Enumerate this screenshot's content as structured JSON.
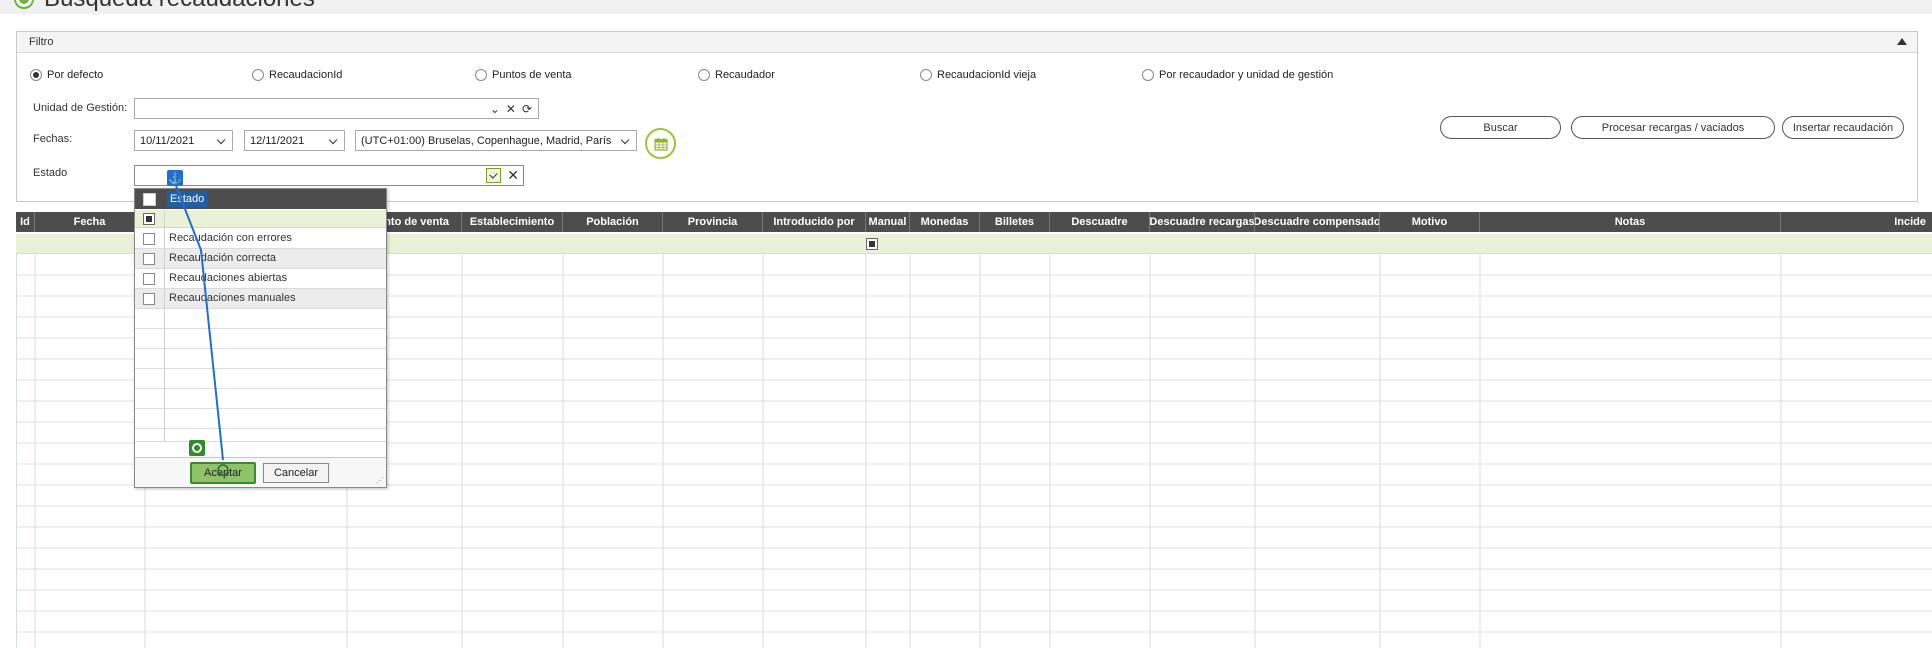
{
  "page": {
    "title": "Búsqueda recaudaciones"
  },
  "filter": {
    "title": "Filtro",
    "radios": [
      {
        "label": "Por defecto",
        "checked": true
      },
      {
        "label": "RecaudacionId",
        "checked": false
      },
      {
        "label": "Puntos de venta",
        "checked": false
      },
      {
        "label": "Recaudador",
        "checked": false
      },
      {
        "label": "RecaudacionId vieja",
        "checked": false
      },
      {
        "label": "Por recaudador y unidad de gestión",
        "checked": false
      }
    ],
    "unidad_label": "Unidad de Gestión:",
    "unidad_value": "",
    "fechas_label": "Fechas:",
    "fecha_desde": "10/11/2021",
    "fecha_hasta": "12/11/2021",
    "timezone": "(UTC+01:00) Bruselas, Copenhague, Madrid, París",
    "estado_label": "Estado",
    "estado_value": ""
  },
  "actions": {
    "buscar": "Buscar",
    "procesar": "Procesar recargas / vaciados",
    "insertar": "Insertar recaudación"
  },
  "grid": {
    "columns": [
      "Id",
      "Fecha",
      "",
      "Punto de venta",
      "Establecimiento",
      "Población",
      "Provincia",
      "Introducido por",
      "Manual",
      "Monedas",
      "Billetes",
      "Descuadre",
      "Descuadre recargas",
      "Descuadre compensado",
      "Motivo",
      "Notas",
      "Incide"
    ]
  },
  "estado_popup": {
    "header": "Estado",
    "options": [
      "Recaudación con errores",
      "Recaudación correcta",
      "Recaudaciones abiertas",
      "Recaudaciones manuales"
    ],
    "accept": "Aceptar",
    "cancel": "Cancelar"
  },
  "colors": {
    "accent": "#6cb33f",
    "grid_header": "#4d4d4d",
    "filter_row": "#eaf1d6",
    "highlight": "#1f5fa8"
  },
  "icons": {
    "title": "radio-selected-icon",
    "collapse": "caret-up-icon",
    "calendar": "calendar-icon",
    "anchor": "anchor-icon",
    "target": "target-icon"
  }
}
